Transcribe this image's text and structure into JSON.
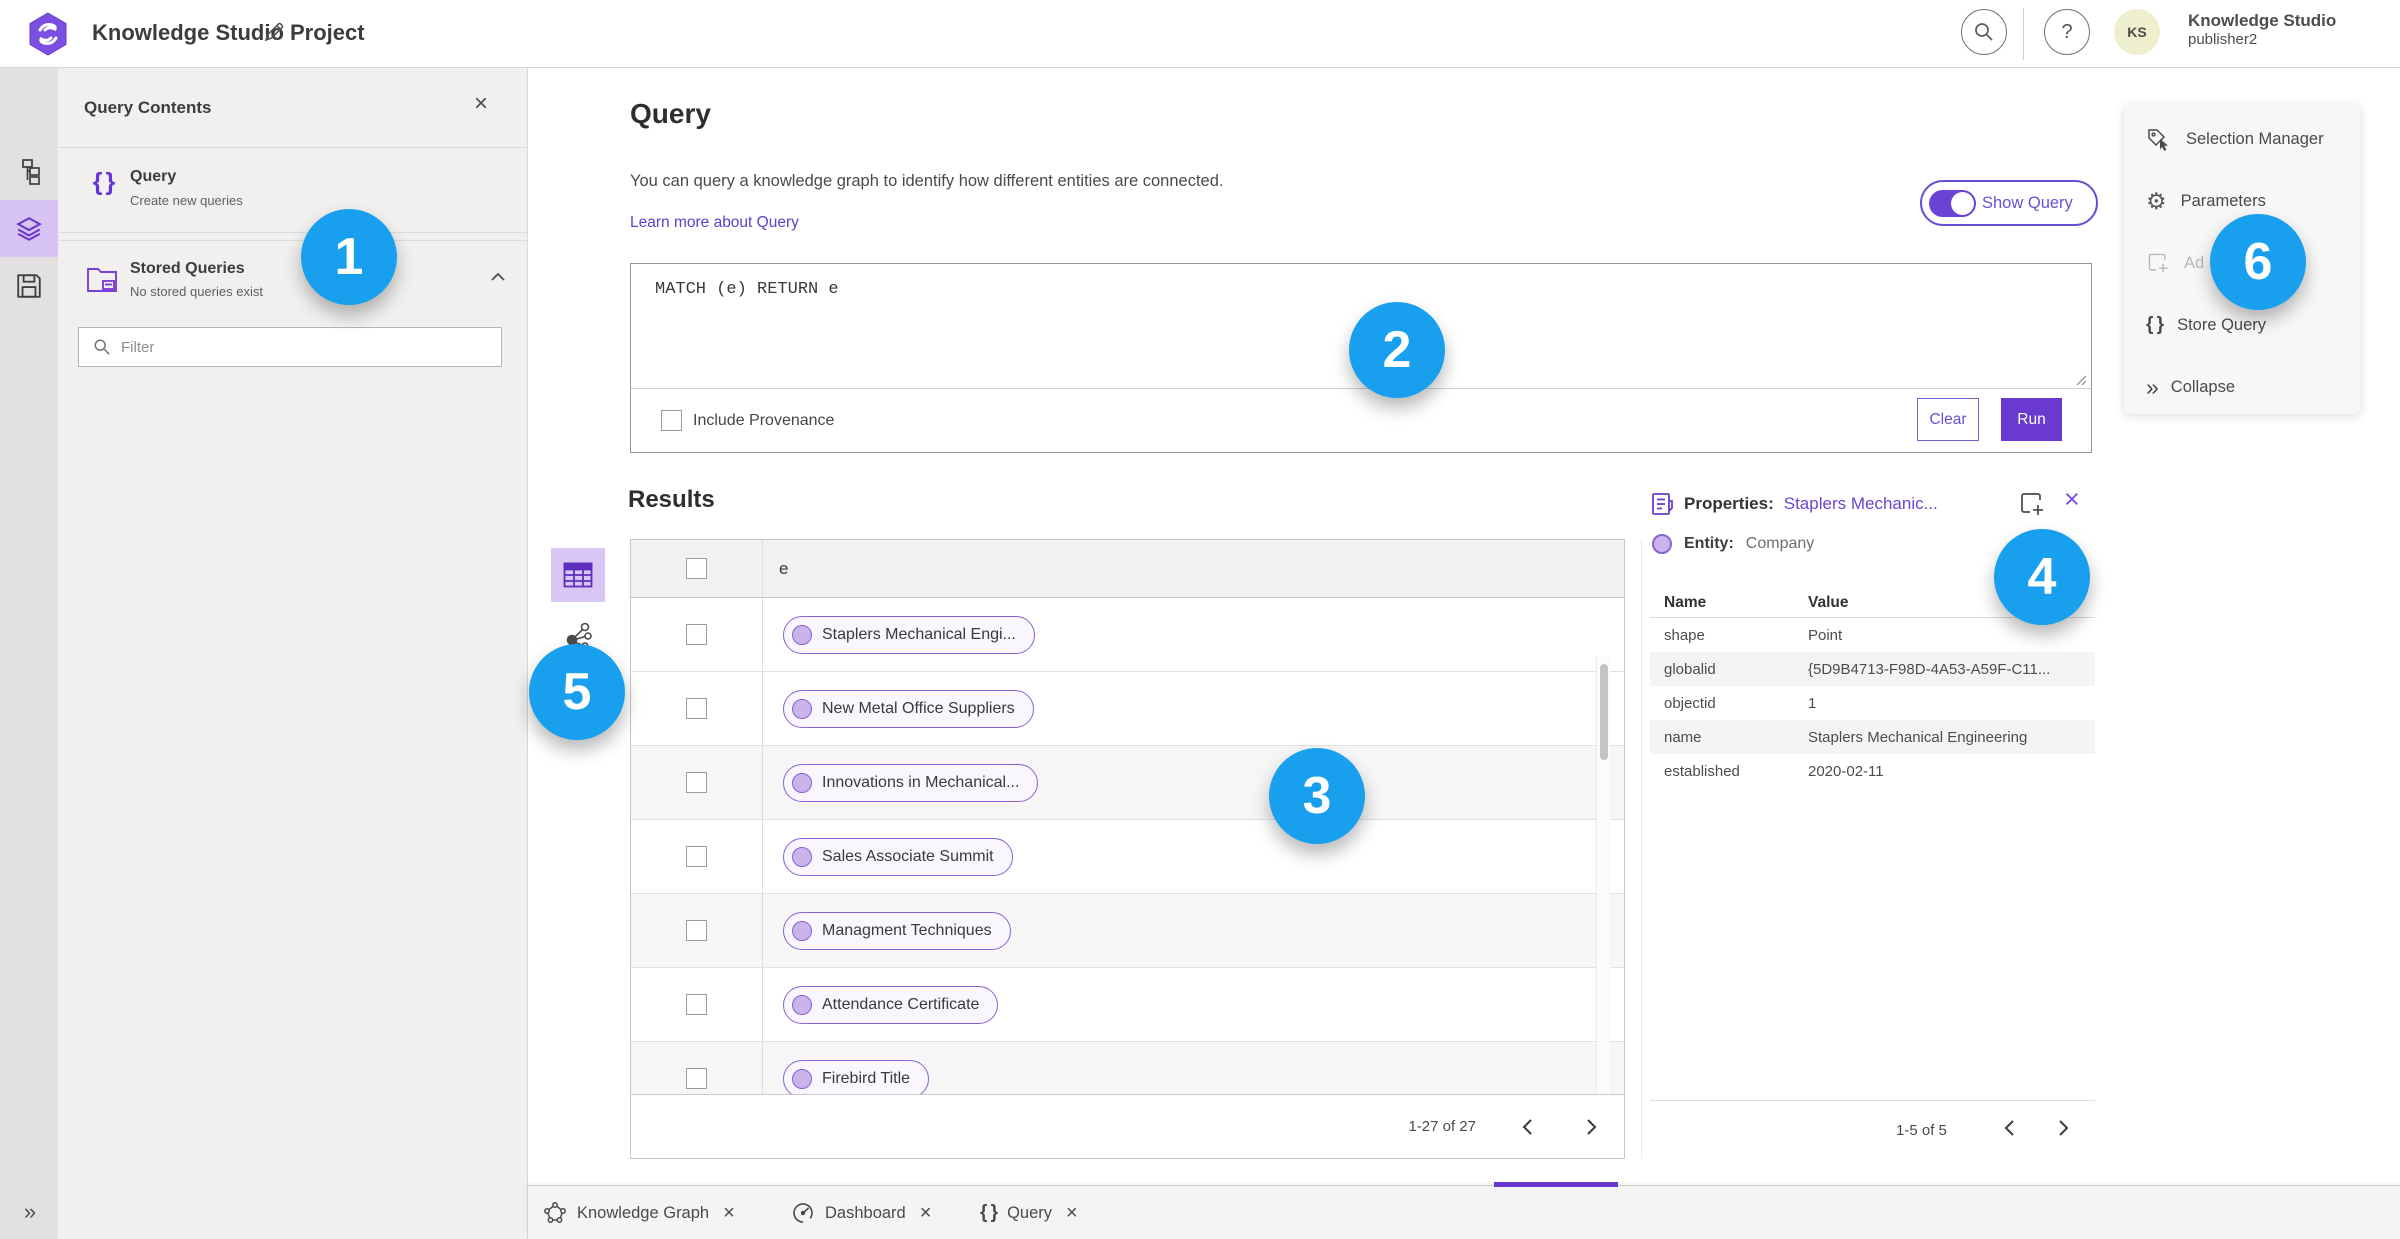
{
  "topbar": {
    "title": "Knowledge Studio Project",
    "avatar_initials": "KS",
    "user_name": "Knowledge Studio",
    "user_role": "publisher2"
  },
  "icons": {
    "braces": "{ }",
    "chevrons_right": "»",
    "question": "?",
    "gear": "⚙"
  },
  "panel": {
    "title": "Query Contents",
    "query_item": {
      "label": "Query",
      "sublabel": "Create new queries"
    },
    "stored_item": {
      "label": "Stored Queries",
      "sublabel": "No stored queries exist"
    },
    "filter_placeholder": "Filter"
  },
  "query": {
    "heading": "Query",
    "description": "You can query a knowledge graph to identify how different entities are connected.",
    "learn_more": "Learn more about Query",
    "show_query_label": "Show Query",
    "code": "MATCH (e) RETURN e",
    "include_provenance": "Include Provenance",
    "clear_label": "Clear",
    "run_label": "Run"
  },
  "results": {
    "heading": "Results",
    "column": "e",
    "rows": [
      {
        "label": "Staplers Mechanical Engi..."
      },
      {
        "label": "New Metal Office Suppliers"
      },
      {
        "label": "Innovations in Mechanical..."
      },
      {
        "label": "Sales Associate Summit"
      },
      {
        "label": "Managment Techniques"
      },
      {
        "label": "Attendance Certificate"
      },
      {
        "label": "Firebird Title"
      }
    ],
    "pagination": "1-27 of 27"
  },
  "properties": {
    "title": "Properties:",
    "entity_link": "Staplers Mechanic...",
    "entity_label": "Entity:",
    "entity_type": "Company",
    "col_name": "Name",
    "col_value": "Value",
    "rows": [
      {
        "name": "shape",
        "value": "Point"
      },
      {
        "name": "globalid",
        "value": "{5D9B4713-F98D-4A53-A59F-C11..."
      },
      {
        "name": "objectid",
        "value": "1"
      },
      {
        "name": "name",
        "value": "Staplers Mechanical Engineering"
      },
      {
        "name": "established",
        "value": "2020-02-11"
      }
    ],
    "pagination": "1-5 of 5"
  },
  "right_menu": {
    "items": [
      {
        "label": "Selection Manager"
      },
      {
        "label": "Parameters"
      },
      {
        "label": "Ad"
      },
      {
        "label": "Store Query"
      },
      {
        "label": "Collapse"
      }
    ]
  },
  "tabs": [
    {
      "label": "Knowledge Graph"
    },
    {
      "label": "Dashboard"
    },
    {
      "label": "Query"
    }
  ],
  "badges": [
    "1",
    "2",
    "3",
    "4",
    "5",
    "6"
  ],
  "colors": {
    "accent_purple": "#6a39d0",
    "accent_light_purple": "#d8c6f5",
    "badge_blue": "#18a0ee",
    "link_purple": "#5b40cc"
  }
}
